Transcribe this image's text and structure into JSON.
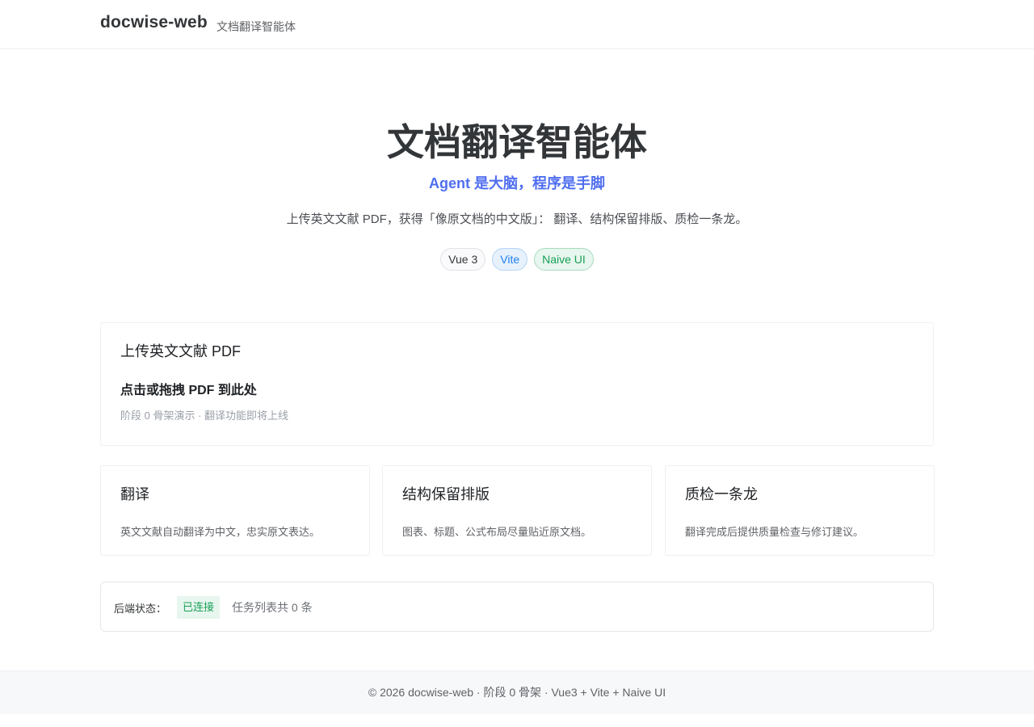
{
  "header": {
    "brand": "docwise-web",
    "subtitle": "文档翻译智能体"
  },
  "hero": {
    "title": "文档翻译智能体",
    "slogan": "Agent 是大脑，程序是手脚",
    "description": "上传英文文献 PDF，获得「像原文档的中文版」： 翻译、结构保留排版、质检一条龙。",
    "tags": [
      {
        "label": "Vue 3",
        "type": "default"
      },
      {
        "label": "Vite",
        "type": "info"
      },
      {
        "label": "Naive UI",
        "type": "success"
      }
    ]
  },
  "upload": {
    "title": "上传英文文献 PDF",
    "drop_label": "点击或拖拽 PDF 到此处",
    "hint": "阶段 0 骨架演示 · 翻译功能即将上线"
  },
  "features": [
    {
      "title": "翻译",
      "desc": "英文文献自动翻译为中文，忠实原文表达。"
    },
    {
      "title": "结构保留排版",
      "desc": "图表、标题、公式布局尽量贴近原文档。"
    },
    {
      "title": "质检一条龙",
      "desc": "翻译完成后提供质量检查与修订建议。"
    }
  ],
  "status": {
    "label": "后端状态：",
    "badge": "已连接",
    "task_count_text": "任务列表共 0 条"
  },
  "footer": {
    "text": "© 2026 docwise-web · 阶段 0 骨架 · Vue3 + Vite + Naive UI"
  },
  "colors": {
    "accent": "#4f6ef0",
    "success": "#18a058",
    "info": "#2080f0"
  }
}
